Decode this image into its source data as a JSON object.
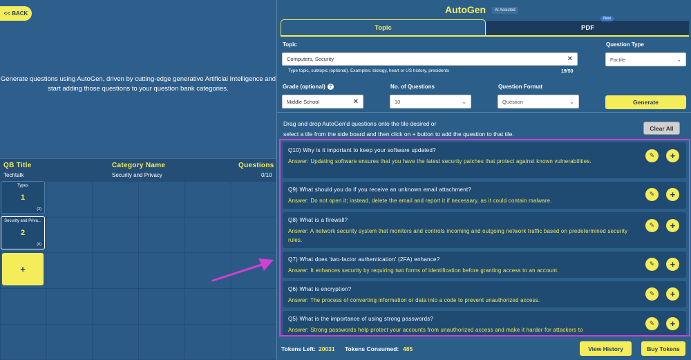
{
  "left": {
    "back_label": "<< BACK",
    "intro_line1": "Generate questions using AutoGen, driven by cutting-edge generative Artificial Intelligence and",
    "intro_line2": "start adding those questions to your question bank categories.",
    "table": {
      "headers": {
        "qb_title": "QB Title",
        "category": "Category Name",
        "questions": "Questions"
      },
      "row": {
        "qb_title": "Techtalk",
        "category": "Security and Privacy",
        "questions": "0/10"
      }
    },
    "tiles": [
      {
        "name": "Types",
        "number": "1",
        "count": "(2)"
      },
      {
        "name": "Security and Priva...",
        "number": "2",
        "count": "(0)"
      }
    ],
    "add_tile_label": "+"
  },
  "right": {
    "title": "AutoGen",
    "ai_badge": "AI Assisted",
    "tabs": [
      {
        "label": "Topic"
      },
      {
        "label": "PDF"
      }
    ],
    "new_badge": "New",
    "form": {
      "topic_label": "Topic",
      "topic_value": "Computers, Security",
      "topic_hint": "Type topic, subtopic (optional). Examples: biology, heart or US history, presidents",
      "topic_counter": "19/50",
      "qtype_label": "Question Type",
      "qtype_value": "Factile",
      "grade_label": "Grade (optional)",
      "grade_value": "Middle School",
      "num_label": "No. of Questions",
      "num_value": "10",
      "format_label": "Question Format",
      "format_value": "Question",
      "generate_label": "Generate"
    },
    "instructions_line1": "Drag and drop AutoGen'd questions onto the tile desired or",
    "instructions_line2": "select a tile from the side board and then click on + button to add the question to that tile.",
    "clear_all_label": "Clear All",
    "questions": [
      {
        "q": "Q10) Why is it important to keep your software updated?",
        "a": "Answer: Updating software ensures that you have the latest security patches that protect against known vulnerabilities."
      },
      {
        "q": "Q9) What should you do if you receive an unknown email attachment?",
        "a": "Answer: Do not open it; instead, delete the email and report it if necessary, as it could contain malware."
      },
      {
        "q": "Q8) What is a firewall?",
        "a": "Answer: A network security system that monitors and controls incoming and outgoing network traffic based on predetermined security rules."
      },
      {
        "q": "Q7) What does 'two-factor authentication' (2FA) enhance?",
        "a": "Answer: It enhances security by requiring two forms of identification before granting access to an account."
      },
      {
        "q": "Q6) What is encryption?",
        "a": "Answer: The process of converting information or data into a code to prevent unauthorized access."
      },
      {
        "q": "Q5) What is the importance of using strong passwords?",
        "a": "Answer: Strong passwords help protect your accounts from unauthorized access and make it harder for attackers to"
      }
    ],
    "footer": {
      "tokens_left_label": "Tokens Left:",
      "tokens_left_value": "20031",
      "tokens_consumed_label": "Tokens Consumed:",
      "tokens_consumed_value": "485",
      "view_history_label": "View History",
      "buy_tokens_label": "Buy Tokens"
    }
  },
  "colors": {
    "background": "#2e5f8c",
    "accent_yellow": "#f5ec5a",
    "highlight_magenta": "#d23fd2",
    "card": "#1f4a72"
  },
  "icons": {
    "edit": "pencil-square-icon",
    "add": "plus-icon",
    "clear": "x-icon",
    "dropdown": "chevron-down-icon",
    "info": "question-circle-icon",
    "annotation": "magenta-arrow"
  }
}
